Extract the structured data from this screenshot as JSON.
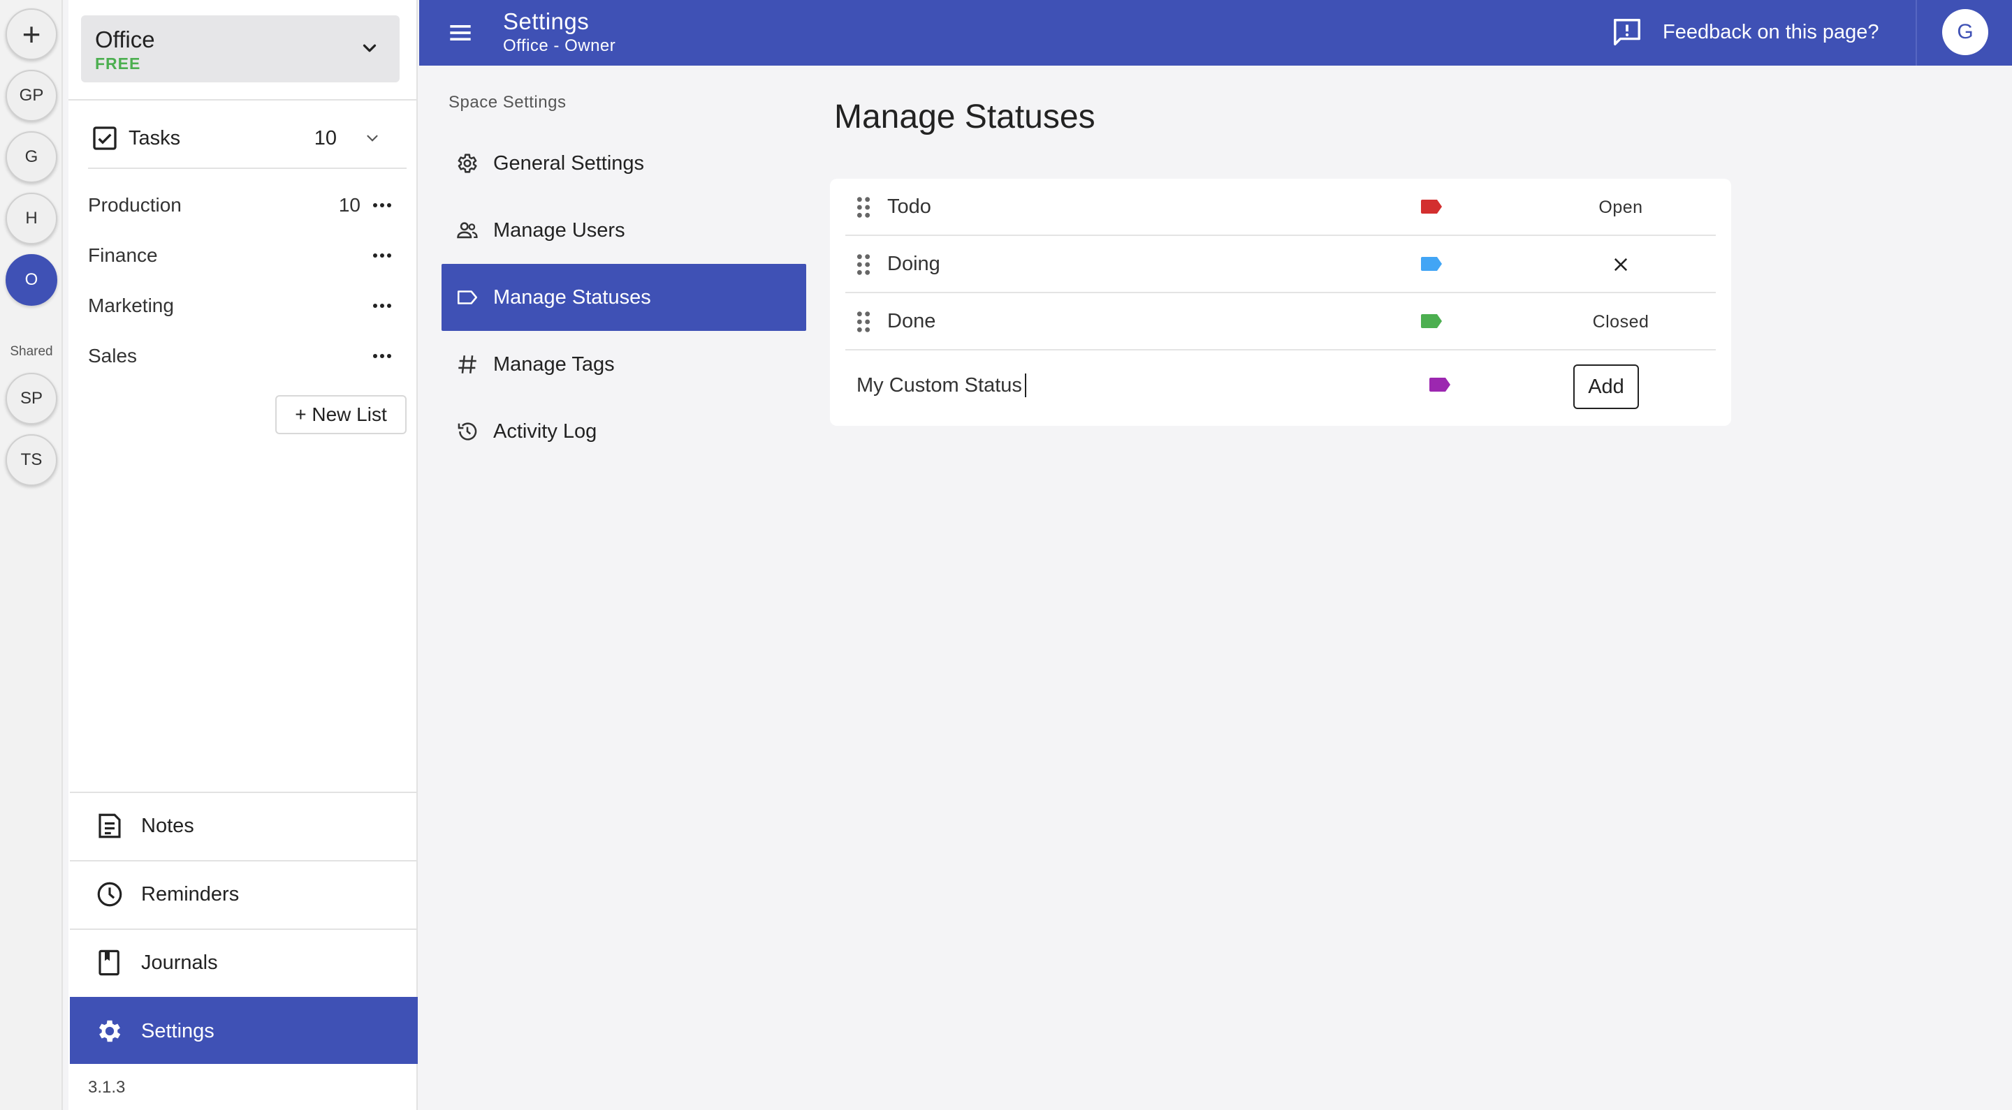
{
  "rail": {
    "add_label": "+",
    "spaces": [
      {
        "initials": "GP",
        "active": false
      },
      {
        "initials": "G",
        "active": false
      },
      {
        "initials": "H",
        "active": false
      },
      {
        "initials": "O",
        "active": true
      }
    ],
    "shared_label": "Shared",
    "shared_spaces": [
      {
        "initials": "SP"
      },
      {
        "initials": "TS"
      }
    ]
  },
  "drawer": {
    "space_name": "Office",
    "space_plan": "FREE",
    "tasks": {
      "title": "Tasks",
      "count": "10"
    },
    "lists": [
      {
        "name": "Production",
        "count": "10"
      },
      {
        "name": "Finance",
        "count": ""
      },
      {
        "name": "Marketing",
        "count": ""
      },
      {
        "name": "Sales",
        "count": ""
      }
    ],
    "new_list_label": "+ New List",
    "nav": [
      {
        "label": "Notes",
        "icon": "notes-icon"
      },
      {
        "label": "Reminders",
        "icon": "clock-icon"
      },
      {
        "label": "Journals",
        "icon": "journal-icon"
      },
      {
        "label": "Settings",
        "icon": "gear-icon",
        "active": true
      }
    ],
    "version": "3.1.3"
  },
  "appbar": {
    "title": "Settings",
    "subtitle": "Office - Owner",
    "feedback_label": "Feedback on this page?",
    "avatar_initial": "G",
    "color": "#3f51b5"
  },
  "subnav": {
    "heading": "Space Settings",
    "items": [
      {
        "label": "General Settings",
        "icon": "gear-outline-icon"
      },
      {
        "label": "Manage Users",
        "icon": "users-icon"
      },
      {
        "label": "Manage Statuses",
        "icon": "label-icon",
        "active": true
      },
      {
        "label": "Manage Tags",
        "icon": "hash-icon"
      },
      {
        "label": "Activity Log",
        "icon": "history-icon"
      }
    ]
  },
  "main": {
    "title": "Manage Statuses",
    "statuses": [
      {
        "name": "Todo",
        "color": "#d32f2f",
        "state": "Open"
      },
      {
        "name": "Doing",
        "color": "#42a5f5",
        "state": ""
      },
      {
        "name": "Done",
        "color": "#4caf50",
        "state": "Closed"
      }
    ],
    "new_status": {
      "value": "My Custom Status",
      "color": "#9c27b0",
      "add_label": "Add"
    }
  }
}
